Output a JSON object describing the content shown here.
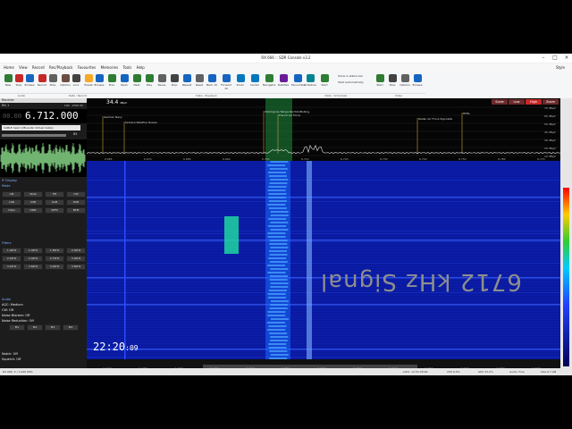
{
  "window": {
    "title": "RX 666 :: SDR Console v3.2",
    "skin_label": "Style"
  },
  "menu": [
    "Home",
    "View",
    "Record",
    "Rec/Playback",
    "Favourites",
    "Memories",
    "Tools",
    "Help"
  ],
  "ribbon": {
    "buttons": [
      "New",
      "Stop",
      "Browse",
      "Record",
      "Stop",
      "Options",
      "Lock",
      "Preset",
      "Browse",
      "Prev",
      "Open",
      "Next",
      "Play",
      "Pause",
      "Stop",
      "Repeat",
      "Reset",
      "Back 10",
      "Forward 10",
      "Zoom",
      "Center",
      "Navigator",
      "Dataflex",
      "Favourites",
      "Schedule",
      "Start",
      "Start",
      "Stop",
      "Options",
      "Browse"
    ],
    "groups": [
      "Audio",
      "Data : Record",
      "Data : Playback",
      "Data : Scheduler",
      "Video"
    ],
    "checks": [
      "Show in status bar",
      "Start automatically"
    ]
  },
  "left": {
    "panel_receive": "Receive",
    "rx_label": "RX 1",
    "frequency": "6.712.000",
    "freq_prefix": "00.00",
    "bandwidth": "100 - 2700 Hz",
    "audio_device": "CABLE Input (VB-Audio Virtual Cable)",
    "volume": "85",
    "if_display": "IF Display",
    "mode_label": "Mode",
    "modes": [
      "AM",
      "Wide",
      "FM",
      "CW",
      "LSB",
      "USB",
      "SAM",
      "DSB",
      "Data",
      "DRM",
      "WFM",
      "NFM"
    ],
    "filters_label": "Filters",
    "filters": [
      "1.0kHz",
      "1.4kHz",
      "1.8kHz",
      "2.0kHz",
      "2.2kHz",
      "2.4kHz",
      "2.7kHz",
      "3.0kHz",
      "3.2kHz",
      "3.6kHz",
      "4.0kHz",
      "3.8kHz"
    ],
    "audio_label": "Audio",
    "agc": "AGC: Medium",
    "cw": "CW: Off",
    "noise_blanker": "Noise Blanker: Off",
    "noise_reduction": "Noise Reduction: Off",
    "mem_buttons": [
      "M1",
      "M2",
      "M3",
      "M4"
    ],
    "notch": "Notch: Off",
    "squelch": "Squelch: Off"
  },
  "spectrum": {
    "level": "34.4",
    "level_unit": "dBµV",
    "tabs": [
      "Scale",
      "Low",
      "High",
      "Zoom"
    ],
    "db_labels": [
      "70 dBµV",
      "60 dBµV",
      "50 dBµV",
      "40 dBµV",
      "30 dBµV",
      "20 dBµV",
      "10 dBµV"
    ],
    "annotations": [
      "German Navy",
      "Samara Weather Russia",
      "US/Virginia Tampa Norfolk/Bolling",
      "French Air Force",
      "Italian Air Force Sigonella",
      "HFDL"
    ],
    "freq_ticks": [
      "6.665",
      "6.670",
      "6.680",
      "6.690",
      "6.700",
      "6.710",
      "6.720",
      "6.730",
      "6.740",
      "6.750",
      "6.760",
      "6.770"
    ]
  },
  "waterfall": {
    "clock": "22:20",
    "clock_seconds": "09",
    "overlay_text": "6712 kHz Signal"
  },
  "scale_ticks": [
    "6.660",
    "6.670",
    "6.680",
    "6.690",
    "6.700",
    "6.710",
    "6.720",
    "6.730",
    "6.740",
    "6.750",
    "6.760",
    "6.770",
    "6.780"
  ],
  "status": {
    "left": "RX 666, 5 / 1,000 MHz",
    "right_items": [
      "+002, 12:52:48:96",
      "CPU 6.6%",
      "GPU 32.2%",
      "Audio: Fine",
      "Size 6.7 GB"
    ]
  },
  "colors": {
    "waterfall": "#0a1aa0",
    "signal_green": "#1fd6a0",
    "accent": "#2ea8ff"
  }
}
